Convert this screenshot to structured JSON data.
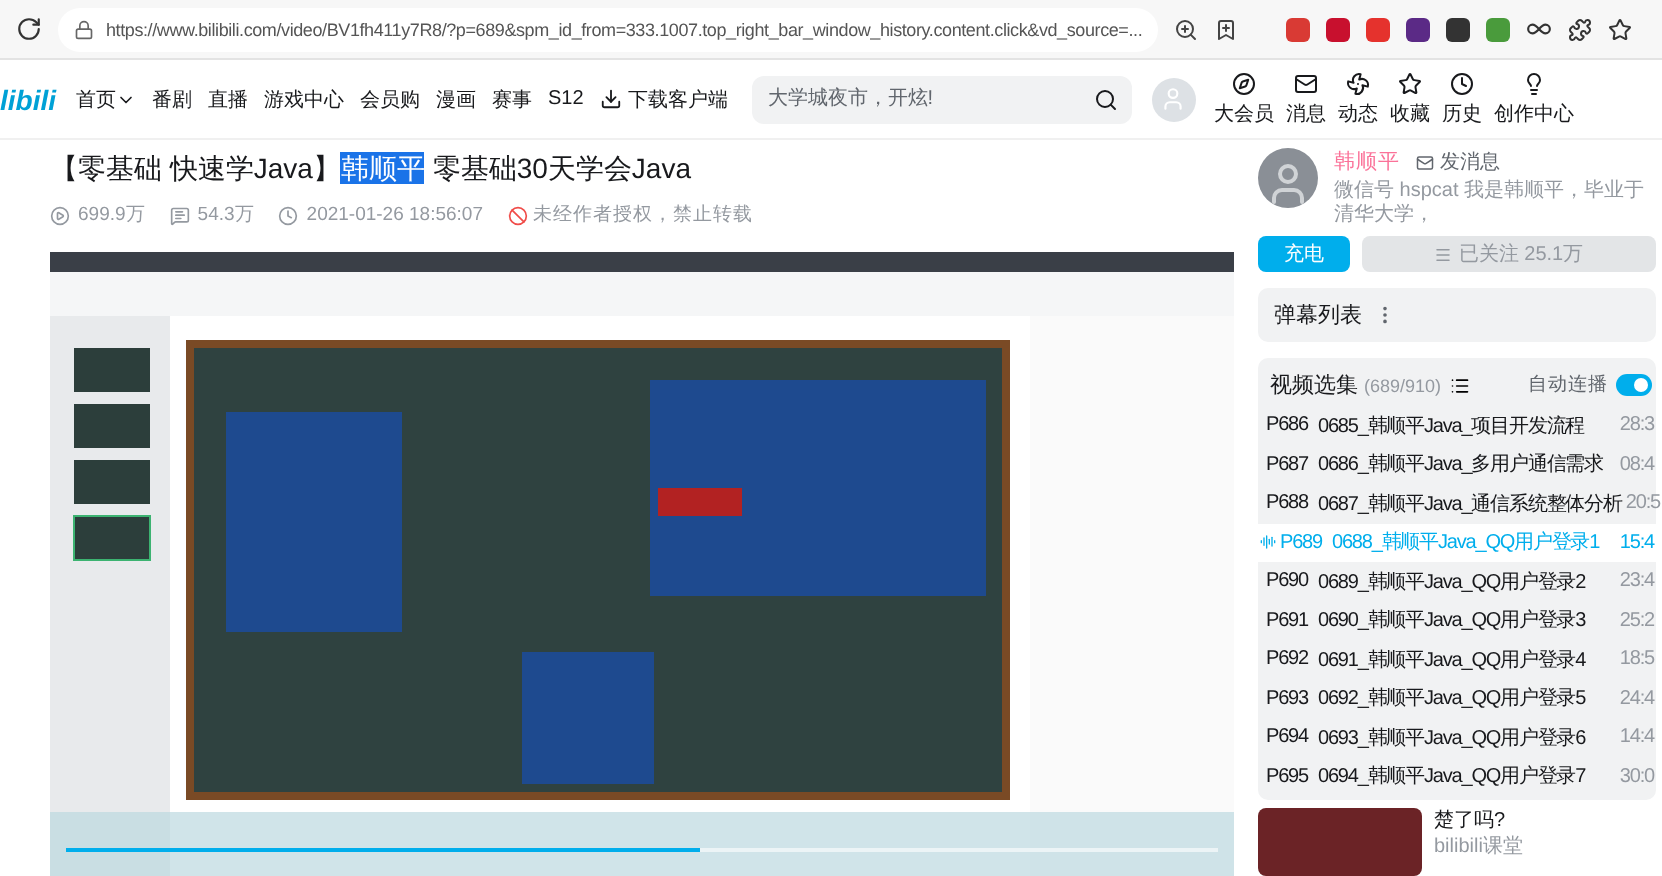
{
  "browser": {
    "url": "https://www.bilibili.com/video/BV1fh411y7R8/?p=689&spm_id_from=333.1007.top_right_bar_window_history.content.click&vd_source=...",
    "extensions": [
      {
        "color": "#d93a34"
      },
      {
        "color": "#c8102e"
      },
      {
        "color": "#e5322d"
      },
      {
        "color": "#5b2a86"
      },
      {
        "color": "#333333"
      },
      {
        "color": "#4a9b3c"
      }
    ]
  },
  "nav": {
    "logo": "libili",
    "items": [
      {
        "label": "首页",
        "dropdown": true
      },
      {
        "label": "番剧",
        "dropdown": false
      },
      {
        "label": "直播",
        "dropdown": false
      },
      {
        "label": "游戏中心",
        "dropdown": false
      },
      {
        "label": "会员购",
        "dropdown": false
      },
      {
        "label": "漫画",
        "dropdown": false
      },
      {
        "label": "赛事",
        "dropdown": false
      },
      {
        "label": "S12",
        "dropdown": false
      }
    ],
    "download": "下载客户端",
    "search": {
      "placeholder": "大学城夜市，开炫!"
    },
    "actions": [
      {
        "kind": "vip",
        "label": "大会员"
      },
      {
        "kind": "message",
        "label": "消息"
      },
      {
        "kind": "dynamic",
        "label": "动态"
      },
      {
        "kind": "favorite",
        "label": "收藏"
      },
      {
        "kind": "history",
        "label": "历史"
      },
      {
        "kind": "creator",
        "label": "创作中心"
      }
    ]
  },
  "video_info": {
    "title_parts": [
      {
        "text": "【零基础 快速学Java】",
        "selected": false
      },
      {
        "text": "韩顺平",
        "selected": true
      },
      {
        "text": " 零基础30天学会Java",
        "selected": false
      }
    ],
    "stats": [
      {
        "kind": "views",
        "text": "699.9万"
      },
      {
        "kind": "danmaku",
        "text": "54.3万"
      },
      {
        "kind": "date",
        "text": "2021-01-26 18:56:07"
      }
    ],
    "notice": "未经作者授权，禁止转载"
  },
  "player": {
    "progress": {
      "level": 0.55
    }
  },
  "uploader": {
    "name": "韩顺平",
    "message": "发消息",
    "bio": "微信号 hspcat 我是韩顺平，毕业于清华大学，",
    "charge": "充电",
    "follow": "已关注 25.1万"
  },
  "danmaku": {
    "title": "弹幕列表"
  },
  "playlist": {
    "title": "视频选集",
    "count": "(689/910)",
    "autoplay": {
      "label": "自动连播",
      "on": true
    },
    "items": [
      {
        "code": "P686",
        "title": "0685_韩顺平Java_项目开发流程",
        "duration": "28:3",
        "selected": false
      },
      {
        "code": "P687",
        "title": "0686_韩顺平Java_多用户通信需求",
        "duration": "08:4",
        "selected": false
      },
      {
        "code": "P688",
        "title": "0687_韩顺平Java_通信系统整体分析",
        "duration": "20:5",
        "selected": false
      },
      {
        "code": "P689",
        "title": "0688_韩顺平Java_QQ用户登录1",
        "duration": "15:4",
        "selected": true
      },
      {
        "code": "P690",
        "title": "0689_韩顺平Java_QQ用户登录2",
        "duration": "23:4",
        "selected": false
      },
      {
        "code": "P691",
        "title": "0690_韩顺平Java_QQ用户登录3",
        "duration": "25:2",
        "selected": false
      },
      {
        "code": "P692",
        "title": "0691_韩顺平Java_QQ用户登录4",
        "duration": "18:5",
        "selected": false
      },
      {
        "code": "P693",
        "title": "0692_韩顺平Java_QQ用户登录5",
        "duration": "24:4",
        "selected": false
      },
      {
        "code": "P694",
        "title": "0693_韩顺平Java_QQ用户登录6",
        "duration": "14:4",
        "selected": false
      },
      {
        "code": "P695",
        "title": "0694_韩顺平Java_QQ用户登录7",
        "duration": "30:0",
        "selected": false
      }
    ]
  },
  "recommend": {
    "title": "楚了吗?",
    "author": "bilibili课堂"
  }
}
